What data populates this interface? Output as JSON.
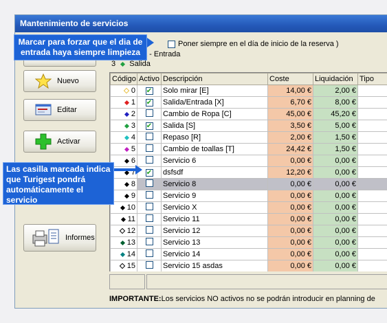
{
  "window": {
    "title": "Mantenimiento de servicios"
  },
  "top_option": {
    "label": "Poner siempre en el día de inicio de la reserva )",
    "checked": false
  },
  "legend": {
    "line1": "a - Entrada",
    "line2_code": "3",
    "line2_label": "Salida"
  },
  "sidebar": {
    "buttons": [
      {
        "label": "Nuevo",
        "icon": "star-icon"
      },
      {
        "label": "Editar",
        "icon": "edit-form-icon"
      },
      {
        "label": "Activar",
        "icon": "plus-icon"
      },
      {
        "label": "Informes",
        "icon": "printer-icon"
      }
    ]
  },
  "grid": {
    "columns": [
      "Código",
      "Activo",
      "Descripción",
      "Coste",
      "Liquidación",
      "Tipo"
    ],
    "rows": [
      {
        "code": "0",
        "active": true,
        "desc": "Solo mirar [E]",
        "coste": "14,00 €",
        "liq": "2,00 €",
        "color": "#e8c040",
        "hollow": true
      },
      {
        "code": "1",
        "active": true,
        "desc": "Salida/Entrada [X]",
        "coste": "6,70 €",
        "liq": "8,00 €",
        "color": "#e02020",
        "hollow": false
      },
      {
        "code": "2",
        "active": false,
        "desc": "Cambio de Ropa [C]",
        "coste": "45,00 €",
        "liq": "45,20 €",
        "color": "#2020c0",
        "hollow": false
      },
      {
        "code": "3",
        "active": true,
        "desc": "Salida [S]",
        "coste": "3,50 €",
        "liq": "5,00 €",
        "color": "#20a040",
        "hollow": false
      },
      {
        "code": "4",
        "active": false,
        "desc": "Repaso [R]",
        "coste": "2,00 €",
        "liq": "1,50 €",
        "color": "#20c0c0",
        "hollow": false
      },
      {
        "code": "5",
        "active": false,
        "desc": "Cambio de toallas [T]",
        "coste": "24,42 €",
        "liq": "1,50 €",
        "color": "#c020c0",
        "hollow": false
      },
      {
        "code": "6",
        "active": false,
        "desc": "Servicio 6",
        "coste": "0,00 €",
        "liq": "0,00 €",
        "color": "#000000",
        "hollow": false
      },
      {
        "code": "7",
        "active": true,
        "desc": "dsfsdf",
        "coste": "12,20 €",
        "liq": "0,00 €",
        "color": "#000000",
        "hollow": false
      },
      {
        "code": "8",
        "active": false,
        "desc": "Servicio 8",
        "coste": "0,00 €",
        "liq": "0,00 €",
        "color": "#000000",
        "hollow": false,
        "selected": true
      },
      {
        "code": "9",
        "active": false,
        "desc": "Servicio 9",
        "coste": "0,00 €",
        "liq": "0,00 €",
        "color": "#000000",
        "hollow": false
      },
      {
        "code": "10",
        "active": false,
        "desc": "Servicio X",
        "coste": "0,00 €",
        "liq": "0,00 €",
        "color": "#000000",
        "hollow": false
      },
      {
        "code": "11",
        "active": false,
        "desc": "Servicio 11",
        "coste": "0,00 €",
        "liq": "0,00 €",
        "color": "#000000",
        "hollow": false
      },
      {
        "code": "12",
        "active": false,
        "desc": "Servicio 12",
        "coste": "0,00 €",
        "liq": "0,00 €",
        "color": "#000000",
        "hollow": true
      },
      {
        "code": "13",
        "active": false,
        "desc": "Servicio 13",
        "coste": "0,00 €",
        "liq": "0,00 €",
        "color": "#006030",
        "hollow": false
      },
      {
        "code": "14",
        "active": false,
        "desc": "Servicio 14",
        "coste": "0,00 €",
        "liq": "0,00 €",
        "color": "#008080",
        "hollow": false
      },
      {
        "code": "15",
        "active": false,
        "desc": "Servicio 15 asdas",
        "coste": "0,00 €",
        "liq": "0,00 €",
        "color": "#000000",
        "hollow": true
      }
    ]
  },
  "footer": {
    "important_label": "IMPORTANTE:",
    "important_text": "Los servicios NO activos no se podrán introducir en planning de"
  },
  "callouts": {
    "top": "Marcar para forzar que el dia de entrada haya siempre limpieza",
    "mid": "Las casilla marcada indica que Turigest pondrá automáticamente el servicio"
  },
  "colors": {
    "accent": "#1d63d6",
    "coste_bg": "#f4c8a8",
    "liq_bg": "#c7e0c2"
  }
}
